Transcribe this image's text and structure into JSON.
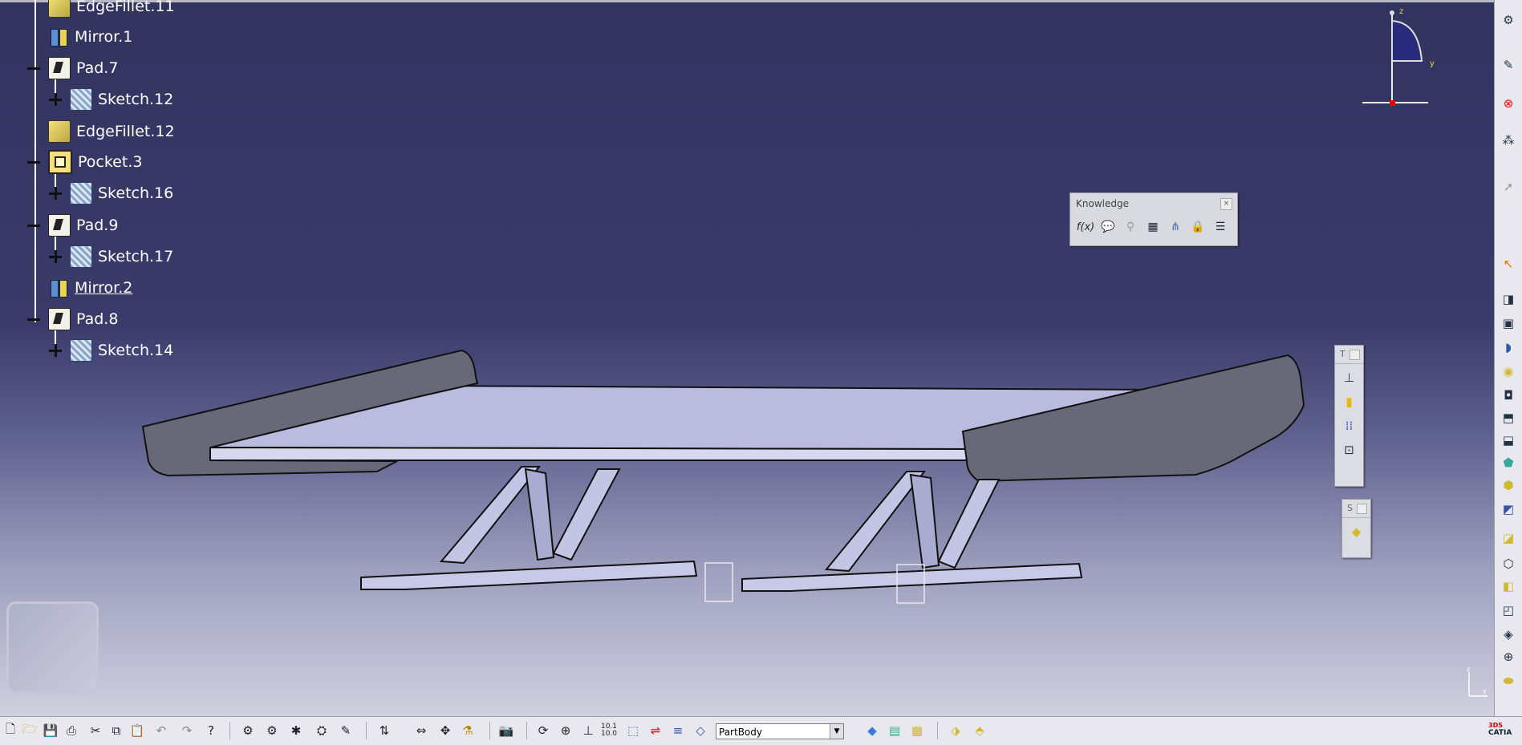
{
  "tree": {
    "items": [
      {
        "label": "EdgeFillet.11",
        "icon": "edge-fillet-icon"
      },
      {
        "label": "Mirror.1",
        "icon": "mirror-icon"
      },
      {
        "label": "Pad.7",
        "icon": "pad-icon"
      },
      {
        "label": "Sketch.12",
        "icon": "sketch-icon"
      },
      {
        "label": "EdgeFillet.12",
        "icon": "edge-fillet-icon"
      },
      {
        "label": "Pocket.3",
        "icon": "pocket-icon"
      },
      {
        "label": "Sketch.16",
        "icon": "sketch-icon"
      },
      {
        "label": "Pad.9",
        "icon": "pad-icon"
      },
      {
        "label": "Sketch.17",
        "icon": "sketch-icon"
      },
      {
        "label": "Mirror.2",
        "icon": "mirror-icon"
      },
      {
        "label": "Pad.8",
        "icon": "pad-icon"
      },
      {
        "label": "Sketch.14",
        "icon": "sketch-icon"
      }
    ]
  },
  "compass": {
    "z_label": "z",
    "y_label": "y"
  },
  "knowledge_toolbar": {
    "title": "Knowledge",
    "buttons": [
      "formula-icon",
      "comment-icon",
      "lightbulb-icon",
      "table-icon",
      "tree-icon",
      "lock-icon",
      "list-icon"
    ],
    "formula_label": "f(x)"
  },
  "toolbar_t": {
    "title": "T"
  },
  "toolbar_s": {
    "title": "S"
  },
  "bottom": {
    "current_body": "PartBody",
    "scale_label_top": "10.1",
    "scale_label_bottom": "10.0"
  },
  "triad": {
    "z_label": "z",
    "y_label": "y"
  },
  "brand": {
    "logo_text": "CATIA",
    "ds_text": "3DS"
  },
  "colors": {
    "background_top": "#33335f",
    "background_bottom": "#d0d0df",
    "model_light": "#b9bbdf",
    "model_dark": "#67687a",
    "toolbar": "#e8e8ee"
  }
}
